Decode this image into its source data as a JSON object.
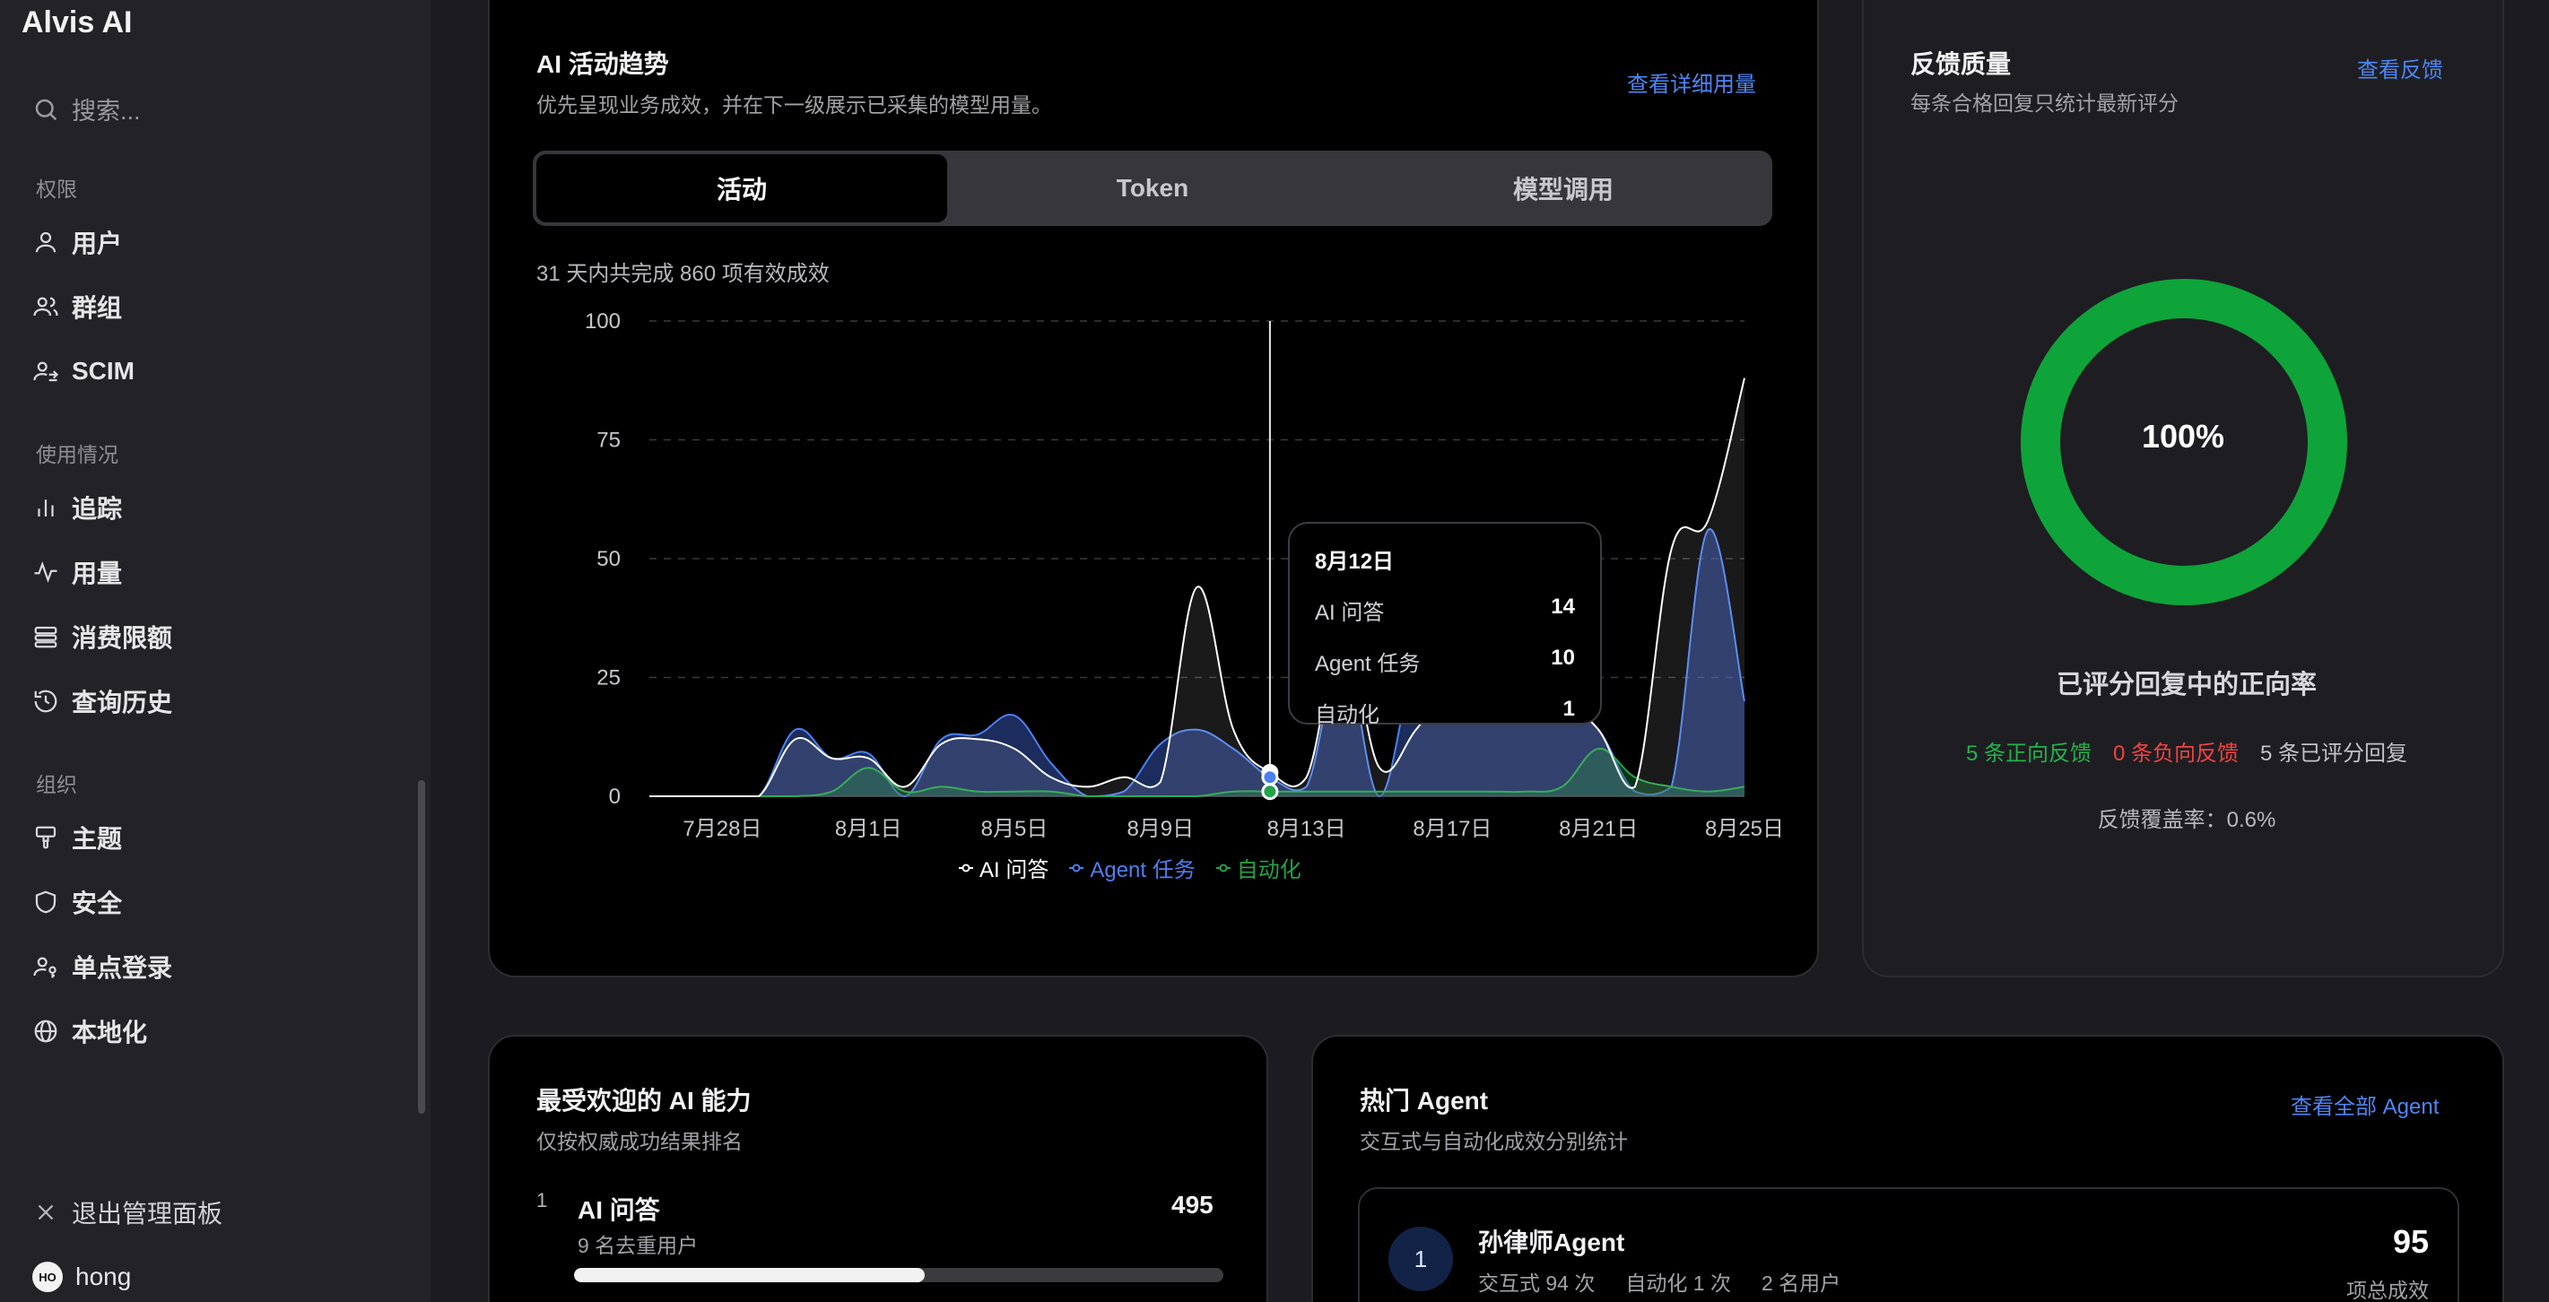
{
  "app": {
    "title": "Alvis AI"
  },
  "sidebar": {
    "search_placeholder": "搜索...",
    "sections": [
      {
        "label": "权限",
        "items": [
          {
            "icon": "user-icon",
            "label": "用户"
          },
          {
            "icon": "group-icon",
            "label": "群组"
          },
          {
            "icon": "scim-icon",
            "label": "SCIM"
          }
        ]
      },
      {
        "label": "使用情况",
        "items": [
          {
            "icon": "bar-chart-icon",
            "label": "追踪"
          },
          {
            "icon": "activity-icon",
            "label": "用量"
          },
          {
            "icon": "quota-icon",
            "label": "消费限额"
          },
          {
            "icon": "history-icon",
            "label": "查询历史"
          }
        ]
      },
      {
        "label": "组织",
        "items": [
          {
            "icon": "theme-icon",
            "label": "主题"
          },
          {
            "icon": "shield-icon",
            "label": "安全"
          },
          {
            "icon": "sso-icon",
            "label": "单点登录"
          },
          {
            "icon": "globe-icon",
            "label": "本地化"
          }
        ]
      }
    ],
    "exit_label": "退出管理面板",
    "user": {
      "initials": "HO",
      "name": "hong"
    }
  },
  "activity": {
    "title": "AI 活动趋势",
    "subtitle": "优先呈现业务成效，并在下一级展示已采集的模型用量。",
    "link": "查看详细用量",
    "tabs": [
      "活动",
      "Token",
      "模型调用"
    ],
    "active_tab": 0,
    "summary": "31 天内共完成 860 项有效成效",
    "tooltip": {
      "date": "8月12日",
      "rows": [
        {
          "label": "AI 问答",
          "value": "14"
        },
        {
          "label": "Agent 任务",
          "value": "10"
        },
        {
          "label": "自动化",
          "value": "1"
        }
      ]
    }
  },
  "chart_data": {
    "type": "area",
    "x": [
      "7月26日",
      "7月27日",
      "7月28日",
      "7月29日",
      "7月30日",
      "7月31日",
      "8月1日",
      "8月2日",
      "8月3日",
      "8月4日",
      "8月5日",
      "8月6日",
      "8月7日",
      "8月8日",
      "8月9日",
      "8月10日",
      "8月11日",
      "8月12日",
      "8月13日",
      "8月14日",
      "8月15日",
      "8月16日",
      "8月17日",
      "8月18日",
      "8月19日",
      "8月20日",
      "8月21日",
      "8月22日",
      "8月23日",
      "8月24日",
      "8月25日"
    ],
    "x_ticks": [
      "7月28日",
      "8月1日",
      "8月5日",
      "8月9日",
      "8月13日",
      "8月17日",
      "8月21日",
      "8月25日"
    ],
    "y_ticks": [
      0,
      25,
      50,
      75,
      100
    ],
    "ylim": [
      0,
      100
    ],
    "series": [
      {
        "name": "AI 问答",
        "color": "#ffffff",
        "values": [
          0,
          0,
          0,
          0,
          12,
          8,
          8,
          2,
          11,
          12,
          10,
          4,
          2,
          4,
          3,
          44,
          14,
          5,
          4,
          34,
          6,
          14,
          24,
          28,
          22,
          20,
          14,
          2,
          52,
          58,
          88
        ]
      },
      {
        "name": "Agent 任务",
        "color": "#4e7ff0",
        "values": [
          0,
          0,
          0,
          0,
          14,
          8,
          9,
          0,
          12,
          13,
          17,
          7,
          0,
          1,
          11,
          14,
          10,
          4,
          2,
          30,
          0,
          28,
          24,
          23,
          21,
          20,
          14,
          1,
          2,
          56,
          20
        ]
      },
      {
        "name": "自动化",
        "color": "#22a447",
        "values": [
          0,
          0,
          0,
          0,
          0,
          1,
          6,
          1,
          2,
          1,
          1,
          1,
          0,
          0,
          0,
          0,
          1,
          1,
          1,
          1,
          1,
          1,
          1,
          1,
          1,
          2,
          10,
          4,
          2,
          1,
          2
        ]
      }
    ],
    "highlight_index": 17,
    "grid": true,
    "legend": "bottom"
  },
  "feedback": {
    "title": "反馈质量",
    "subtitle": "每条合格回复只统计最新评分",
    "link": "查看反馈",
    "rate_label": "100%",
    "rate_value": 1.0,
    "caption": "已评分回复中的正向率",
    "positive": "5 条正向反馈",
    "negative": "0 条负向反馈",
    "rated": "5 条已评分回复",
    "coverage": "反馈覆盖率：0.6%"
  },
  "capabilities": {
    "title": "最受欢迎的 AI 能力",
    "subtitle": "仅按权威成功结果排名",
    "items": [
      {
        "rank": "1",
        "name": "AI 问答",
        "value": "495",
        "meta": "9 名去重用户",
        "share": 0.54
      }
    ]
  },
  "agents": {
    "title": "热门 Agent",
    "subtitle": "交互式与自动化成效分别统计",
    "link": "查看全部 Agent",
    "items": [
      {
        "rank": "1",
        "name": "孙律师Agent",
        "interactive": "交互式 94 次",
        "automation": "自动化 1 次",
        "users": "2 名用户",
        "total": "95",
        "total_label": "项总成效"
      }
    ]
  }
}
